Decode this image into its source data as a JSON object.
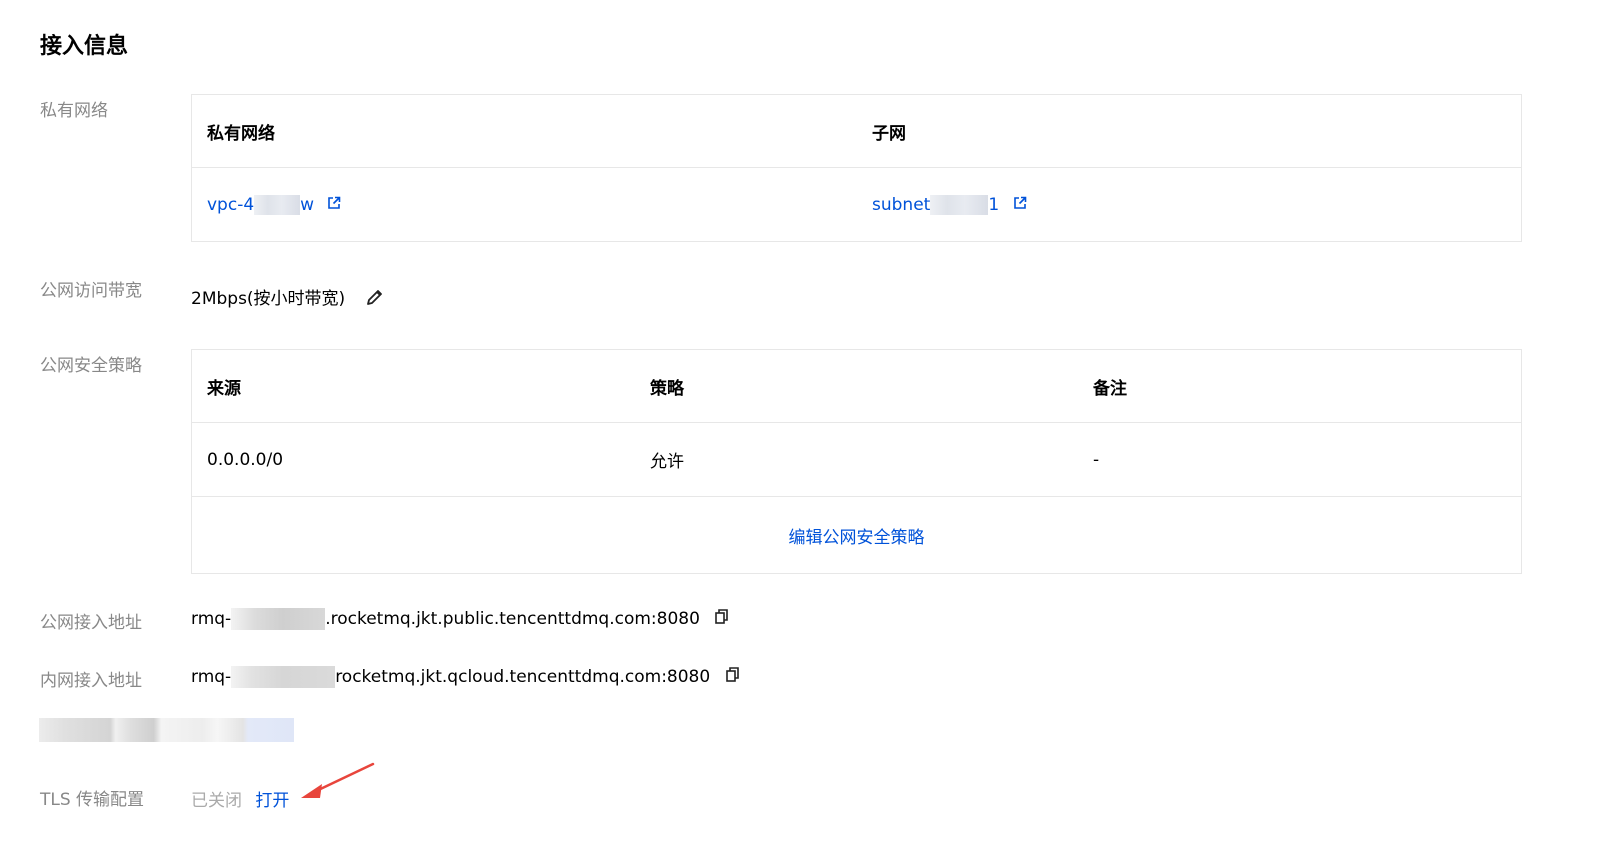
{
  "section_title": "接入信息",
  "vpc": {
    "label": "私有网络",
    "headers": [
      "私有网络",
      "子网"
    ],
    "vpc_id_prefix": "vpc-4",
    "vpc_id_suffix": "w",
    "subnet_prefix": "subnet",
    "subnet_suffix": "1"
  },
  "bandwidth": {
    "label": "公网访问带宽",
    "value": "2Mbps(按小时带宽)"
  },
  "security": {
    "label": "公网安全策略",
    "headers": [
      "来源",
      "策略",
      "备注"
    ],
    "rows": [
      [
        "0.0.0.0/0",
        "允许",
        "-"
      ]
    ],
    "edit_link": "编辑公网安全策略"
  },
  "public_endpoint": {
    "label": "公网接入地址",
    "prefix": "rmq-",
    "suffix": ".rocketmq.jkt.public.tencenttdmq.com:8080"
  },
  "private_endpoint": {
    "label": "内网接入地址",
    "prefix": "rmq-",
    "suffix": "rocketmq.jkt.qcloud.tencenttdmq.com:8080"
  },
  "tls": {
    "label": "TLS 传输配置",
    "status": "已关闭",
    "action": "打开"
  },
  "colors": {
    "link": "#0052d9",
    "label": "#888888",
    "annotation_arrow": "#e8453c"
  },
  "icons": [
    "external-link-icon",
    "edit-pencil-icon",
    "copy-icon",
    "annotation-arrow"
  ]
}
